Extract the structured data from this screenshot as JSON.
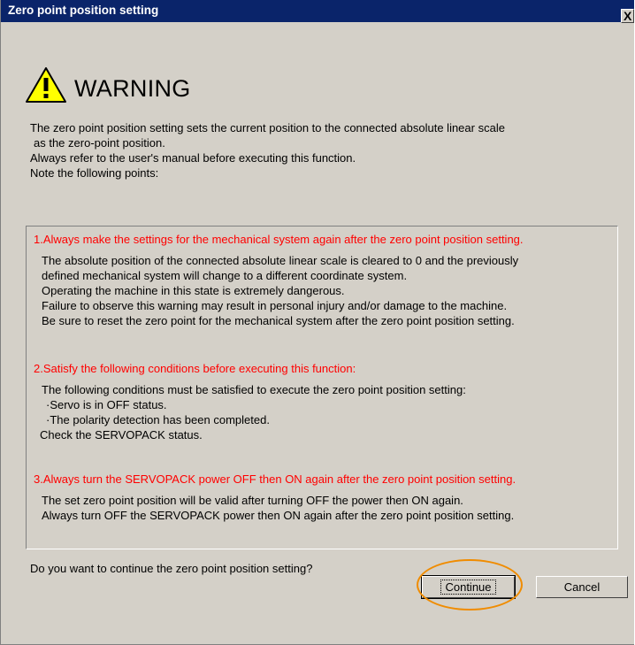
{
  "window": {
    "title": "Zero point position setting",
    "close_label": "X"
  },
  "warning": {
    "icon": "warning-triangle-icon",
    "title": "WARNING"
  },
  "intro": {
    "lines": [
      "The zero point position setting sets the current position to the connected absolute linear scale",
      "as the zero-point position.",
      "Always refer to the user's manual before executing this function.",
      "Note the following points:"
    ]
  },
  "sections": [
    {
      "heading": "1.Always make the settings for the mechanical system again after the zero point position setting.",
      "lines": [
        "The absolute position of the connected absolute linear scale is cleared to 0 and the previously",
        "defined mechanical system will change to a different coordinate system.",
        "Operating the machine in this state is extremely dangerous.",
        "Failure to observe this warning may result in personal injury and/or damage to the machine.",
        "Be sure to reset the zero point for the mechanical system after the zero point position setting."
      ]
    },
    {
      "heading": "2.Satisfy the following conditions before executing this function:",
      "lines": [
        "The following conditions must be satisfied to execute the zero point position setting:",
        "·Servo is in OFF status.",
        "·The polarity detection has been completed.",
        "Check the SERVOPACK status."
      ]
    },
    {
      "heading": "3.Always turn the SERVOPACK power OFF then ON again after the zero point position setting.",
      "lines": [
        "The set zero point position will be valid after turning OFF the power then ON again.",
        "Always turn OFF the SERVOPACK power then ON again after the zero point position setting."
      ]
    }
  ],
  "question": "Do you want to continue the zero point position setting?",
  "buttons": {
    "continue_label": "Continue",
    "cancel_label": "Cancel"
  },
  "colors": {
    "title_bar": "#0a246a",
    "dialog_bg": "#d4d0c8",
    "warning_heading": "#ff0000",
    "highlight_ring": "#f08c00",
    "warning_icon_fill": "#ffff00"
  }
}
